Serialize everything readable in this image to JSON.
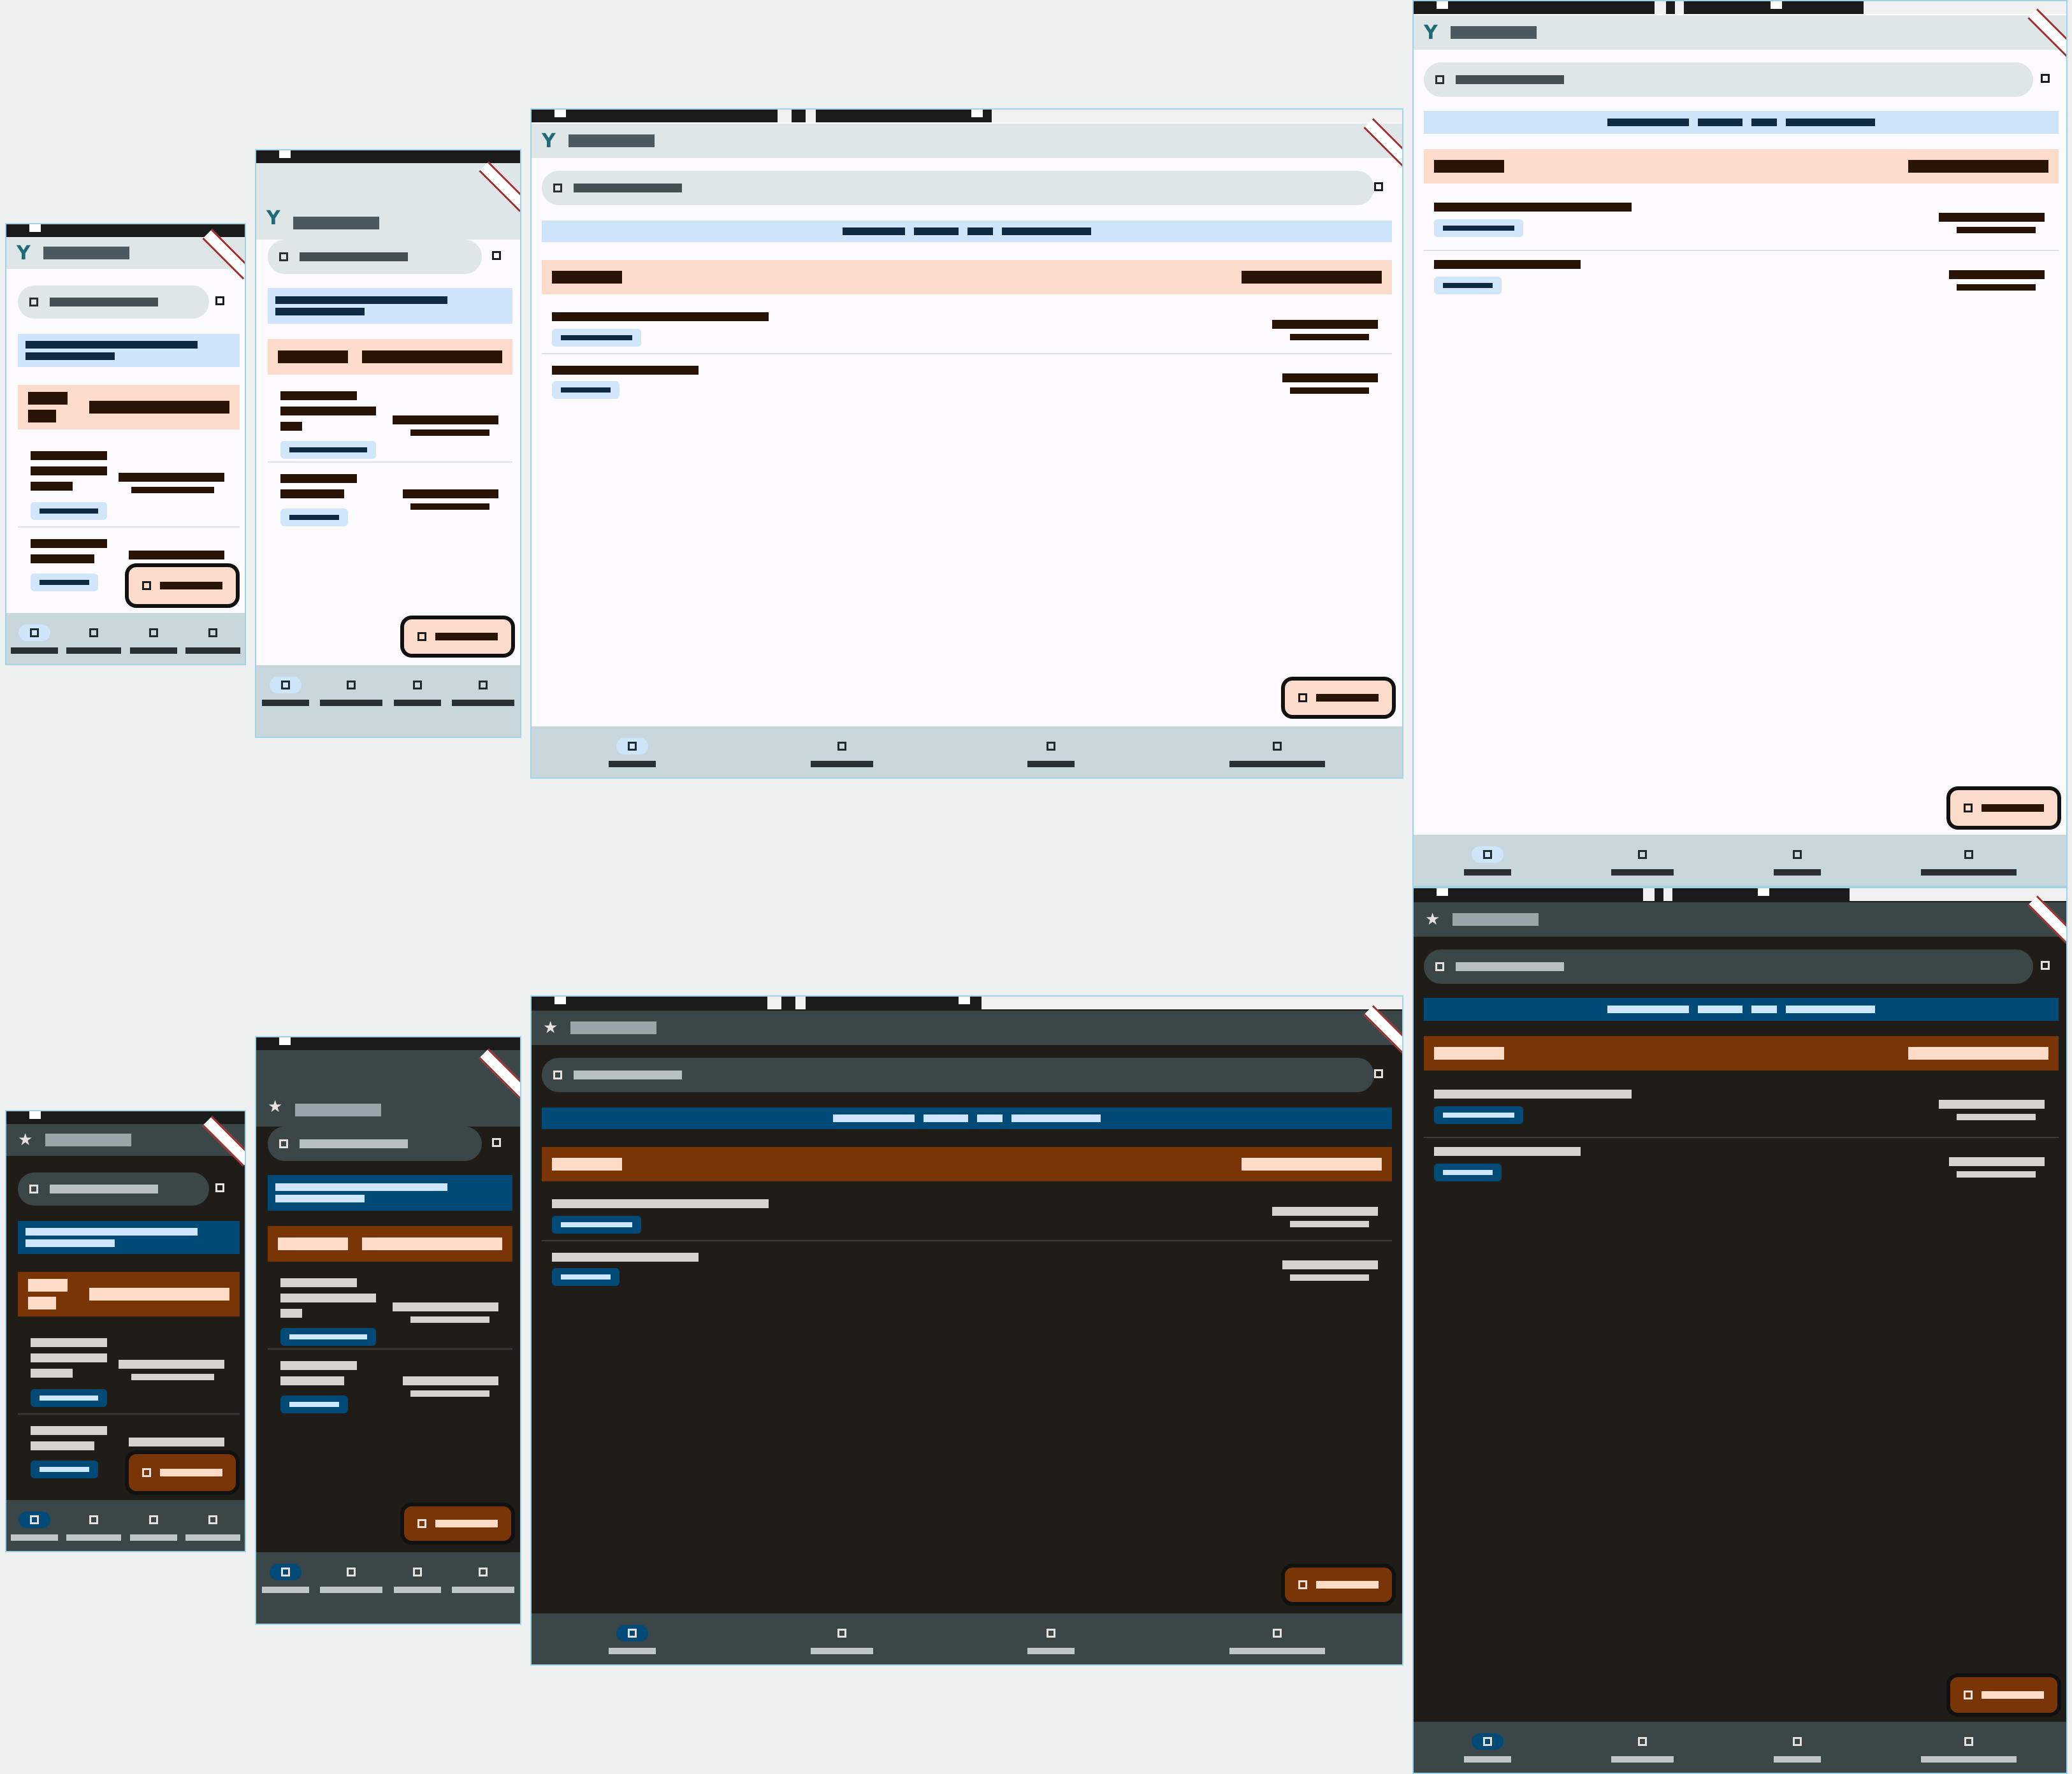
{
  "screens": [
    {
      "theme": "light",
      "form": "phone-small",
      "app_logo": "Y"
    },
    {
      "theme": "light",
      "form": "phone",
      "app_logo": "Y"
    },
    {
      "theme": "light",
      "form": "tablet",
      "app_logo": "Y"
    },
    {
      "theme": "light",
      "form": "large",
      "app_logo": "Y"
    },
    {
      "theme": "dark",
      "form": "phone-small",
      "app_logo": "★"
    },
    {
      "theme": "dark",
      "form": "phone",
      "app_logo": "★"
    },
    {
      "theme": "dark",
      "form": "tablet",
      "app_logo": "★"
    },
    {
      "theme": "dark",
      "form": "large",
      "app_logo": "★"
    }
  ],
  "colors": {
    "light_surface": "#fdfbff",
    "light_appbar": "#dfe6e8",
    "light_banner": "#cfe5fb",
    "light_header": "#fddccb",
    "dark_surface": "#201c18",
    "dark_appbar": "#3b4649",
    "dark_banner": "#004a77",
    "dark_header": "#793505",
    "frame_border": "#9fd3e6"
  },
  "icons": {
    "search": "search-icon",
    "action": "square-icon",
    "fab": "add-icon",
    "nav": [
      "nav-icon-1",
      "nav-icon-2",
      "nav-icon-3",
      "nav-icon-4"
    ],
    "debug_ribbon": "debug-ribbon"
  },
  "list_rows": 2,
  "nav_items": 4,
  "active_nav_index": 0
}
